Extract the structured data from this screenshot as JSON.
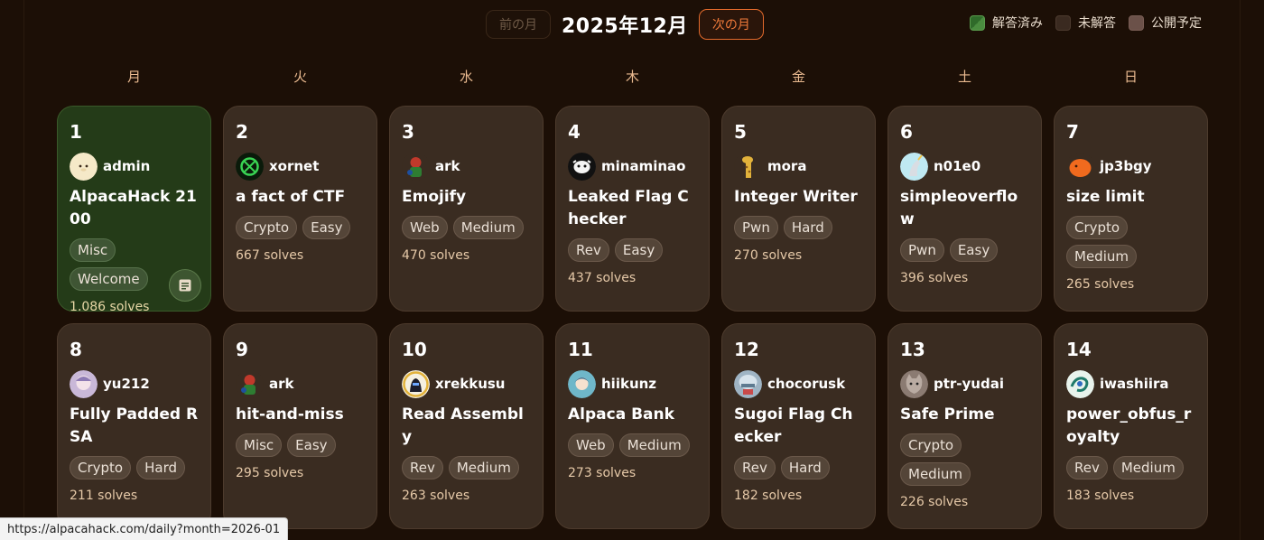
{
  "nav": {
    "prev_label": "前の月",
    "month_title": "2025年12月",
    "next_label": "次の月"
  },
  "legend": [
    {
      "label": "解答済み",
      "color": "#2f6b2a"
    },
    {
      "label": "未解答",
      "color": "#3a2a20"
    },
    {
      "label": "公開予定",
      "color": "#6b5149"
    }
  ],
  "weekdays": [
    "月",
    "火",
    "水",
    "木",
    "金",
    "土",
    "日"
  ],
  "challenges": [
    {
      "day": "1",
      "author": "admin",
      "avatar_icon": "alpaca-avatar-icon",
      "title": "AlpacaHack 2100",
      "tags": [
        "Misc",
        "Welcome"
      ],
      "solves": "1,086 solves",
      "solved": true,
      "writeup_icon": "writeup-document-icon"
    },
    {
      "day": "2",
      "author": "xornet",
      "avatar_icon": "green-ring-avatar-icon",
      "title": "a fact of CTF",
      "tags": [
        "Crypto",
        "Easy"
      ],
      "solves": "667 solves",
      "solved": false
    },
    {
      "day": "3",
      "author": "ark",
      "avatar_icon": "character-avatar-icon",
      "title": "Emojify",
      "tags": [
        "Web",
        "Medium"
      ],
      "solves": "470 solves",
      "solved": false
    },
    {
      "day": "4",
      "author": "minaminao",
      "avatar_icon": "cow-avatar-icon",
      "title": "Leaked Flag Checker",
      "tags": [
        "Rev",
        "Easy"
      ],
      "solves": "437 solves",
      "solved": false
    },
    {
      "day": "5",
      "author": "mora",
      "avatar_icon": "giraffe-avatar-icon",
      "title": "Integer Writer",
      "tags": [
        "Pwn",
        "Hard"
      ],
      "solves": "270 solves",
      "solved": false
    },
    {
      "day": "6",
      "author": "n01e0",
      "avatar_icon": "unicorn-avatar-icon",
      "title": "simpleoverflow",
      "tags": [
        "Pwn",
        "Easy"
      ],
      "solves": "396 solves",
      "solved": false
    },
    {
      "day": "7",
      "author": "jp3bgy",
      "avatar_icon": "orange-blob-avatar-icon",
      "title": "size limit",
      "tags": [
        "Crypto",
        "Medium"
      ],
      "solves": "265 solves",
      "solved": false
    },
    {
      "day": "8",
      "author": "yu212",
      "avatar_icon": "anime-avatar-icon",
      "title": "Fully Padded RSA",
      "tags": [
        "Crypto",
        "Hard"
      ],
      "solves": "211 solves",
      "solved": false
    },
    {
      "day": "9",
      "author": "ark",
      "avatar_icon": "character-avatar-icon",
      "title": "hit-and-miss",
      "tags": [
        "Misc",
        "Easy"
      ],
      "solves": "295 solves",
      "solved": false
    },
    {
      "day": "10",
      "author": "xrekkusu",
      "avatar_icon": "halo-avatar-icon",
      "title": "Read Assembly",
      "tags": [
        "Rev",
        "Medium"
      ],
      "solves": "263 solves",
      "solved": false
    },
    {
      "day": "11",
      "author": "hiikunz",
      "avatar_icon": "girl-avatar-icon",
      "title": "Alpaca Bank",
      "tags": [
        "Web",
        "Medium"
      ],
      "solves": "273 solves",
      "solved": false
    },
    {
      "day": "12",
      "author": "chocorusk",
      "avatar_icon": "helmet-avatar-icon",
      "title": "Sugoi Flag Checker",
      "tags": [
        "Rev",
        "Hard"
      ],
      "solves": "182 solves",
      "solved": false
    },
    {
      "day": "13",
      "author": "ptr-yudai",
      "avatar_icon": "cat-avatar-icon",
      "title": "Safe Prime",
      "tags": [
        "Crypto",
        "Medium"
      ],
      "solves": "226 solves",
      "solved": false
    },
    {
      "day": "14",
      "author": "iwashiira",
      "avatar_icon": "swirl-avatar-icon",
      "title": "power_obfus_royalty",
      "tags": [
        "Rev",
        "Medium"
      ],
      "solves": "183 solves",
      "solved": false
    }
  ],
  "status_url": "https://alpacahack.com/daily?month=2026-01"
}
